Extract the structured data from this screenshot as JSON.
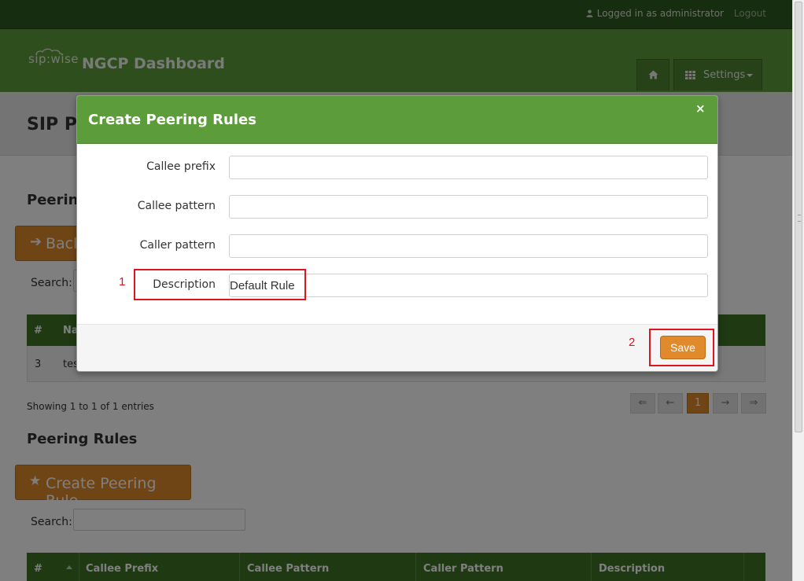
{
  "topbar": {
    "user_text": "Logged in as administrator",
    "logout": "Logout"
  },
  "brand": {
    "logo": "sip:wise",
    "title": "NGCP Dashboard"
  },
  "nav": {
    "home_icon": "home-icon",
    "settings_label": "Settings",
    "settings_icon": "grid-icon"
  },
  "page": {
    "title": "SIP Pe"
  },
  "groups_section": {
    "title": "Peering",
    "back_label": "Back",
    "search_label": "Search:",
    "header_hash": "#",
    "header_name": "Na",
    "row": {
      "id": "3",
      "name": "tes"
    },
    "info": "Showing 1 to 1 of 1 entries",
    "pager": [
      "⇐",
      "←",
      "1",
      "→",
      "⇒"
    ]
  },
  "rules_section": {
    "title": "Peering Rules",
    "create_label": "Create Peering Rule",
    "search_label": "Search:",
    "columns": [
      "#",
      "Callee Prefix",
      "Callee Pattern",
      "Caller Pattern",
      "Description"
    ]
  },
  "modal": {
    "title": "Create Peering Rules",
    "close": "×",
    "fields": [
      {
        "label": "Callee prefix",
        "value": ""
      },
      {
        "label": "Callee pattern",
        "value": ""
      },
      {
        "label": "Caller pattern",
        "value": ""
      },
      {
        "label": "Description",
        "value": "Default Rule"
      }
    ],
    "save_label": "Save"
  },
  "annotations": [
    {
      "number": "1"
    },
    {
      "number": "2"
    }
  ],
  "colors": {
    "header_green": "#5f9c3a",
    "dark_green": "#2f5a1f",
    "table_green": "#3e7527",
    "accent_orange": "#e08a2c",
    "annotation_red": "#e0141f"
  }
}
